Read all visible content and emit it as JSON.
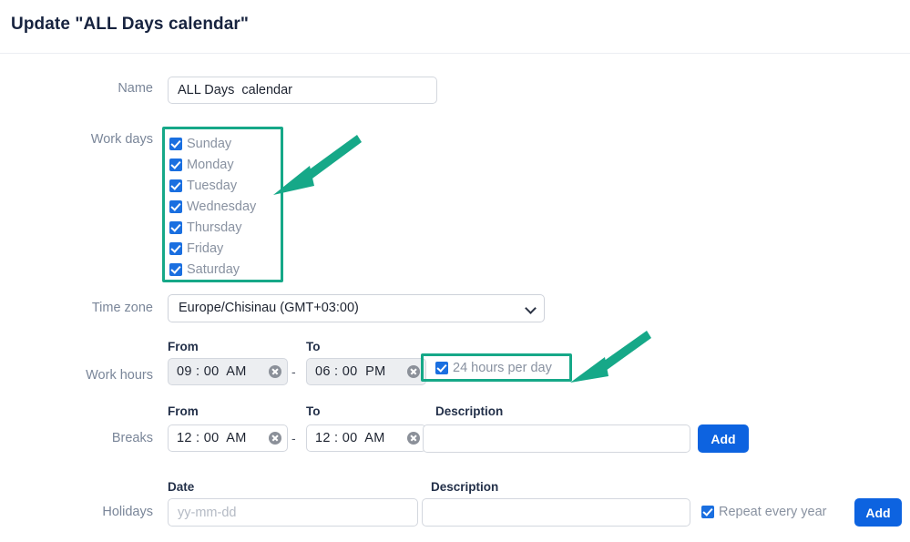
{
  "header": {
    "title": "Update \"ALL Days calendar\""
  },
  "form": {
    "name": {
      "label": "Name",
      "value": "ALL Days  calendar",
      "placeholder": ""
    },
    "work_days": {
      "label": "Work days",
      "days": [
        {
          "label": "Sunday",
          "checked": true
        },
        {
          "label": "Monday",
          "checked": true
        },
        {
          "label": "Tuesday",
          "checked": true
        },
        {
          "label": "Wednesday",
          "checked": true
        },
        {
          "label": "Thursday",
          "checked": true
        },
        {
          "label": "Friday",
          "checked": true
        },
        {
          "label": "Saturday",
          "checked": true
        }
      ]
    },
    "time_zone": {
      "label": "Time zone",
      "selected": "Europe/Chisinau (GMT+03:00)"
    },
    "work_hours": {
      "label": "Work hours",
      "from_head": "From",
      "to_head": "To",
      "from_value": "09 : 00  AM",
      "to_value": "06 : 00  PM",
      "dash": "-",
      "all_day_label": "24 hours per day",
      "all_day_checked": true
    },
    "breaks": {
      "label": "Breaks",
      "from_head": "From",
      "to_head": "To",
      "description_head": "Description",
      "from_value": "12 : 00  AM",
      "to_value": "12 : 00  AM",
      "dash": "-",
      "description_value": "",
      "description_placeholder": "",
      "add_label": "Add"
    },
    "holidays": {
      "label": "Holidays",
      "date_head": "Date",
      "description_head": "Description",
      "date_value": "",
      "date_placeholder": "yy-mm-dd",
      "description_value": "",
      "description_placeholder": "",
      "repeat_label": "Repeat every year",
      "repeat_checked": true,
      "add_label": "Add"
    }
  },
  "annotations": {
    "arrow_color": "#16a888",
    "highlight_color": "#16a888",
    "arrows": [
      {
        "name": "arrow-to-work-days",
        "target": "work-days-list"
      },
      {
        "name": "arrow-to-24-hours",
        "target": "24-hours-per-day-checkbox"
      }
    ]
  },
  "colors": {
    "primary_button": "#0d63e0",
    "checkbox": "#1a6fe0",
    "title": "#17233f",
    "label": "#7a8699",
    "highlight": "#16a888"
  }
}
